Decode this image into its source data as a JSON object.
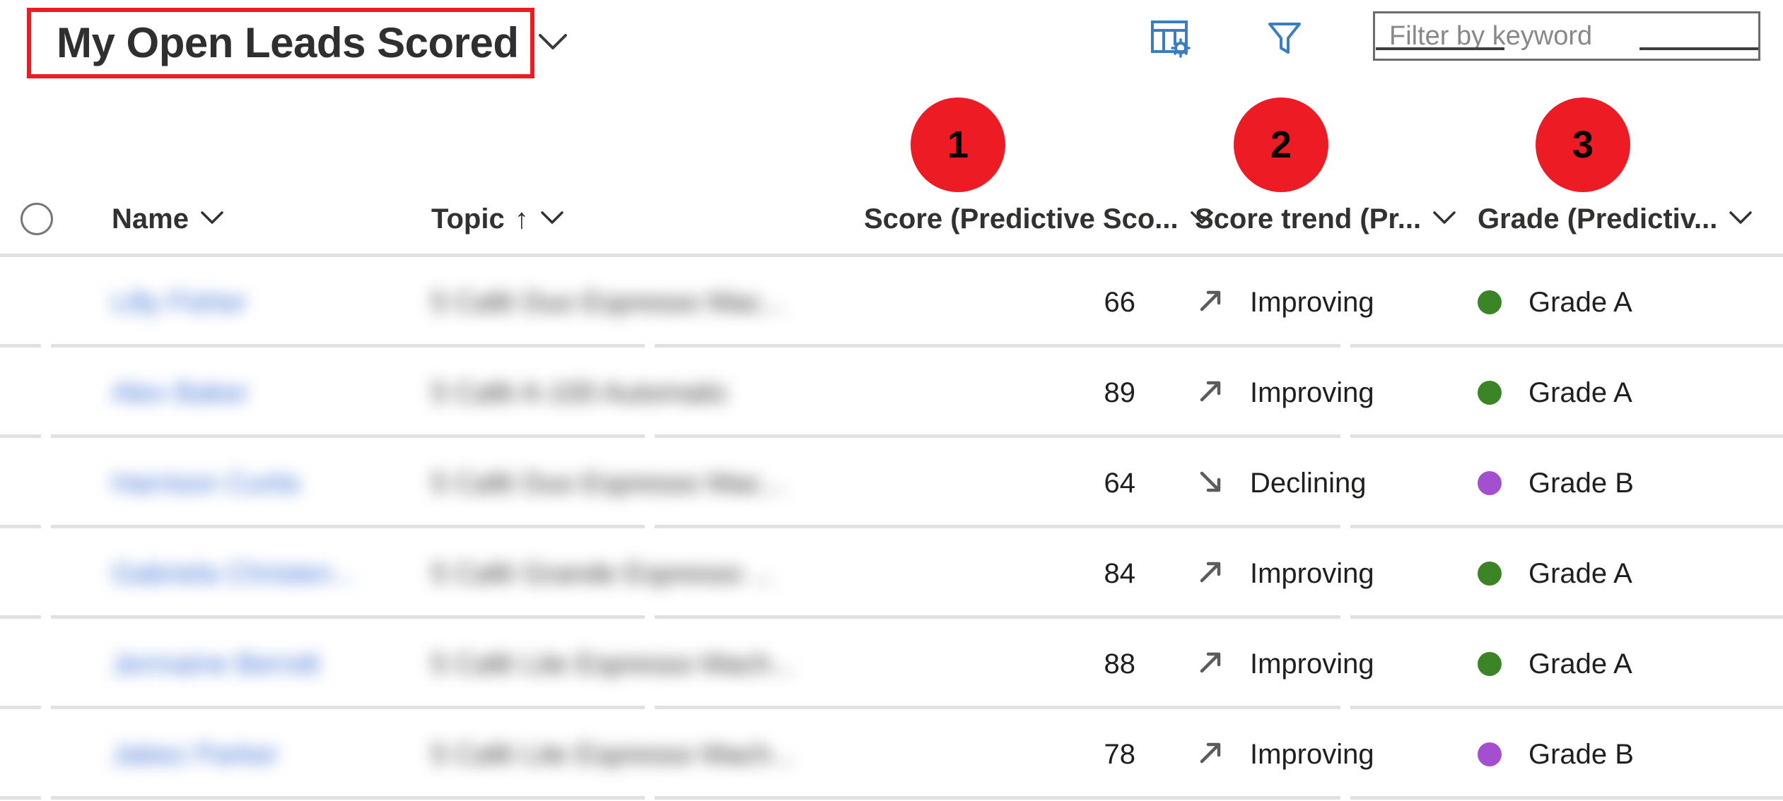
{
  "command_bar": {
    "view_title": "My Open Leads Scored",
    "view_chevron_icon": "chevron-down-icon",
    "edit_columns_icon": "edit-columns-icon",
    "filter_icon": "filter-funnel-icon",
    "keyword_filter_placeholder": "Filter by keyword",
    "keyword_filter_value": ""
  },
  "callouts": [
    {
      "number": "1"
    },
    {
      "number": "2"
    },
    {
      "number": "3"
    }
  ],
  "grid": {
    "select_all": "",
    "columns": [
      {
        "key": "name",
        "label": "Name",
        "sort": "",
        "chevron": "chevron-down-icon"
      },
      {
        "key": "topic",
        "label": "Topic",
        "sort": "↑",
        "chevron": "chevron-down-icon"
      },
      {
        "key": "score",
        "label": "Score (Predictive Sco...",
        "sort": "",
        "chevron": "chevron-down-icon"
      },
      {
        "key": "trend",
        "label": "Score trend (Pr...",
        "sort": "",
        "chevron": "chevron-down-icon"
      },
      {
        "key": "grade",
        "label": "Grade (Predictiv...",
        "sort": "",
        "chevron": "chevron-down-icon"
      }
    ],
    "rows": [
      {
        "name": "Lilly Fisher",
        "topic": "5 Café Duo Espresso Mac...",
        "score": "66",
        "trend": "Improving",
        "trend_icon": "arrow-up-right-icon",
        "grade": "Grade A",
        "grade_color": "#3B8526"
      },
      {
        "name": "Alex Baker",
        "topic": "5 Café A-100 Automatic",
        "score": "89",
        "trend": "Improving",
        "trend_icon": "arrow-up-right-icon",
        "grade": "Grade A",
        "grade_color": "#3B8526"
      },
      {
        "name": "Harrison Curtis",
        "topic": "5 Café Duo Espresso Mac...",
        "score": "64",
        "trend": "Declining",
        "trend_icon": "arrow-down-right-icon",
        "grade": "Grade B",
        "grade_color": "#A34FD0"
      },
      {
        "name": "Gabriela Christen...",
        "topic": "5 Café Grande Espresso ...",
        "score": "84",
        "trend": "Improving",
        "trend_icon": "arrow-up-right-icon",
        "grade": "Grade A",
        "grade_color": "#3B8526"
      },
      {
        "name": "Jermaine Berndt",
        "topic": "5 Café Lite Espresso Mach...",
        "score": "88",
        "trend": "Improving",
        "trend_icon": "arrow-up-right-icon",
        "grade": "Grade A",
        "grade_color": "#3B8526"
      },
      {
        "name": "Jabez Parker",
        "topic": "5 Café Lite Espresso Mach...",
        "score": "78",
        "trend": "Improving",
        "trend_icon": "arrow-up-right-icon",
        "grade": "Grade B",
        "grade_color": "#A34FD0"
      }
    ]
  },
  "colors": {
    "annotation_red": "#ED1C24",
    "link_blue": "#3b6fd4",
    "icon_blue": "#3a7ebf",
    "grade_a_green": "#3B8526",
    "grade_b_purple": "#A34FD0"
  }
}
